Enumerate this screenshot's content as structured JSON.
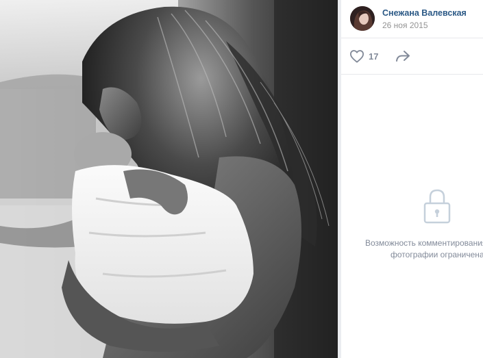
{
  "author": {
    "name": "Снежана Валевская",
    "date": "26 ноя 2015"
  },
  "actions": {
    "like_count": "17",
    "like_icon": "heart-outline-icon",
    "share_icon": "share-arrow-icon"
  },
  "comments": {
    "restricted_icon": "lock-icon",
    "restricted_line1": "Возможность комментирования",
    "restricted_line2": "фотографии ограничена"
  },
  "colors": {
    "link": "#2a5885",
    "muted": "#939393",
    "icon": "#828a99",
    "lock": "#c5d0db"
  }
}
